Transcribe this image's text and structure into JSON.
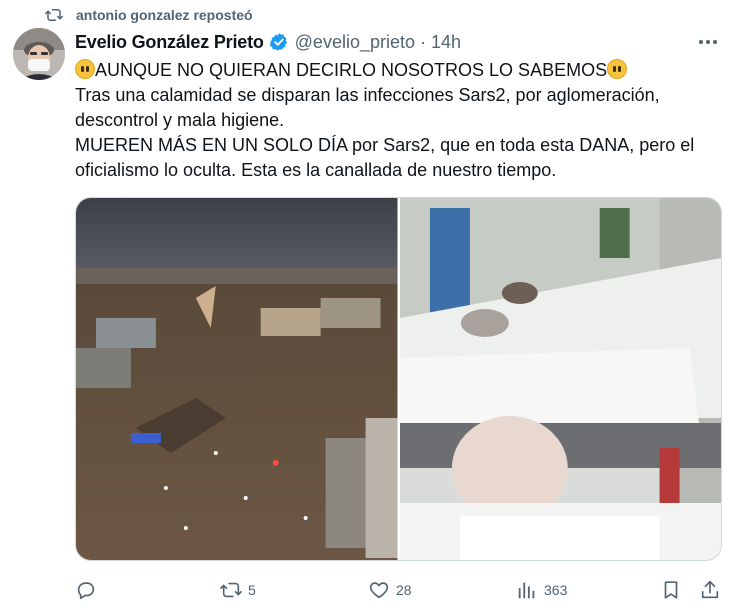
{
  "repost": {
    "text": "antonio gonzalez reposteó",
    "icon": "repost-icon"
  },
  "tweet": {
    "author_name": "Evelio González Prieto",
    "handle": "@evelio_prieto",
    "separator": "·",
    "time": "14h",
    "verified_color": "#1d9bf0",
    "lines": [
      "AUNQUE NO QUIERAN DECIRLO NOSOTROS LO SABEMOS",
      "Tras una calamidad se disparan las infecciones Sars2, por aglomeración, descontrol y mala higiene.",
      "MUEREN MÁS EN UN SOLO DÍA por Sars2, que en toda esta DANA, pero el oficialismo lo oculta. Esta es la canallada de nuestro tiempo."
    ]
  },
  "actions": {
    "reply_count": "",
    "repost_count": "5",
    "like_count": "28",
    "views_count": "363"
  },
  "colors": {
    "secondary_text": "#536471",
    "repost_active": "#536471"
  }
}
